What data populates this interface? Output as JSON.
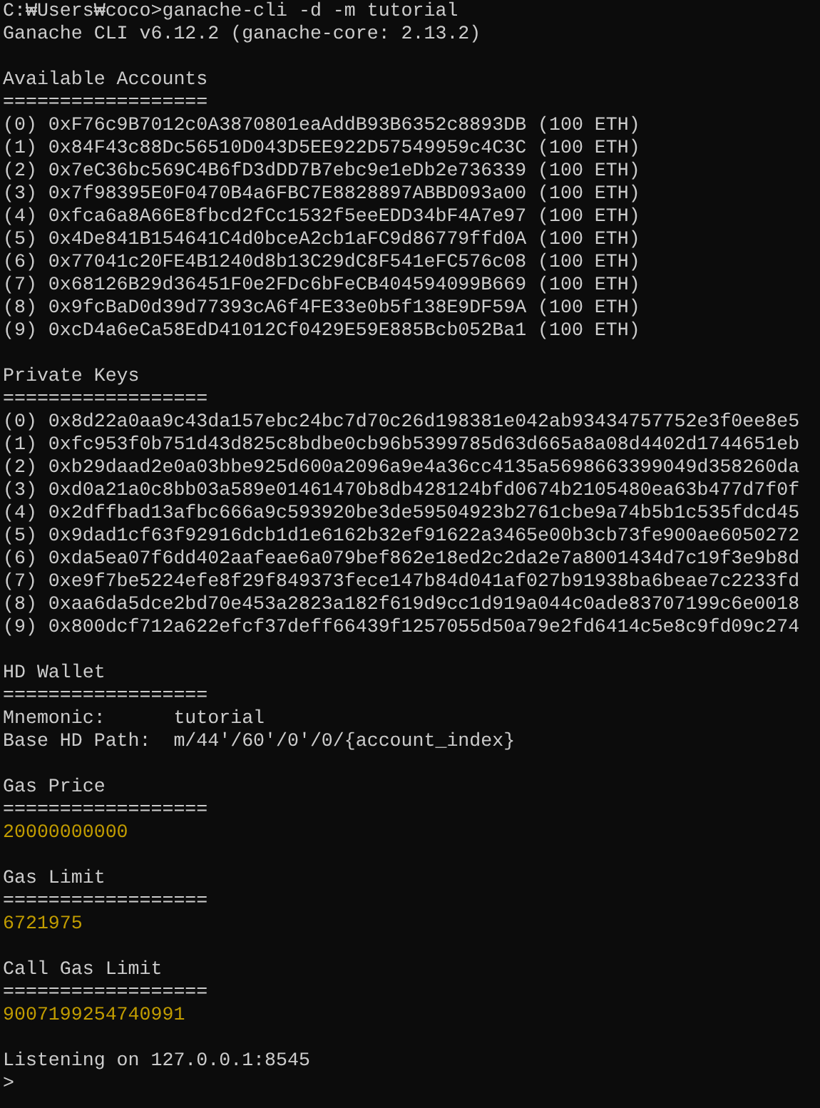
{
  "terminal": {
    "lines": [
      {
        "kind": "command",
        "text": "C:₩Users₩coco>ganache-cli -d -m tutorial"
      },
      {
        "kind": "output",
        "text": "Ganache CLI v6.12.2 (ganache-core: 2.13.2)"
      },
      {
        "kind": "blank"
      },
      {
        "kind": "output",
        "text": "Available Accounts"
      },
      {
        "kind": "output",
        "text": "=================="
      },
      {
        "kind": "output",
        "text": "(0) 0xF76c9B7012c0A3870801eaAddB93B6352c8893DB (100 ETH)"
      },
      {
        "kind": "output",
        "text": "(1) 0x84F43c88Dc56510D043D5EE922D57549959c4C3C (100 ETH)"
      },
      {
        "kind": "output",
        "text": "(2) 0x7eC36bc569C4B6fD3dDD7B7ebc9e1eDb2e736339 (100 ETH)"
      },
      {
        "kind": "output",
        "text": "(3) 0x7f98395E0F0470B4a6FBC7E8828897ABBD093a00 (100 ETH)"
      },
      {
        "kind": "output",
        "text": "(4) 0xfca6a8A66E8fbcd2fCc1532f5eeEDD34bF4A7e97 (100 ETH)"
      },
      {
        "kind": "output",
        "text": "(5) 0x4De841B154641C4d0bceA2cb1aFC9d86779ffd0A (100 ETH)"
      },
      {
        "kind": "output",
        "text": "(6) 0x77041c20FE4B1240d8b13C29dC8F541eFC576c08 (100 ETH)"
      },
      {
        "kind": "output",
        "text": "(7) 0x68126B29d36451F0e2FDc6bFeCB404594099B669 (100 ETH)"
      },
      {
        "kind": "output",
        "text": "(8) 0x9fcBaD0d39d77393cA6f4FE33e0b5f138E9DF59A (100 ETH)"
      },
      {
        "kind": "output",
        "text": "(9) 0xcD4a6eCa58EdD41012Cf0429E59E885Bcb052Ba1 (100 ETH)"
      },
      {
        "kind": "blank"
      },
      {
        "kind": "output",
        "text": "Private Keys"
      },
      {
        "kind": "output",
        "text": "=================="
      },
      {
        "kind": "output",
        "text": "(0) 0x8d22a0aa9c43da157ebc24bc7d70c26d198381e042ab93434757752e3f0ee8e5"
      },
      {
        "kind": "output",
        "text": "(1) 0xfc953f0b751d43d825c8bdbe0cb96b5399785d63d665a8a08d4402d1744651eb"
      },
      {
        "kind": "output",
        "text": "(2) 0xb29daad2e0a03bbe925d600a2096a9e4a36cc4135a5698663399049d358260da"
      },
      {
        "kind": "output",
        "text": "(3) 0xd0a21a0c8bb03a589e01461470b8db428124bfd0674b2105480ea63b477d7f0f"
      },
      {
        "kind": "output",
        "text": "(4) 0x2dffbad13afbc666a9c593920be3de59504923b2761cbe9a74b5b1c535fdcd45"
      },
      {
        "kind": "output",
        "text": "(5) 0x9dad1cf63f92916dcb1d1e6162b32ef91622a3465e00b3cb73fe900ae6050272"
      },
      {
        "kind": "output",
        "text": "(6) 0xda5ea07f6dd402aafeae6a079bef862e18ed2c2da2e7a8001434d7c19f3e9b8d"
      },
      {
        "kind": "output",
        "text": "(7) 0xe9f7be5224efe8f29f849373fece147b84d041af027b91938ba6beae7c2233fd"
      },
      {
        "kind": "output",
        "text": "(8) 0xaa6da5dce2bd70e453a2823a182f619d9cc1d919a044c0ade83707199c6e0018"
      },
      {
        "kind": "output",
        "text": "(9) 0x800dcf712a622efcf37deff66439f1257055d50a79e2fd6414c5e8c9fd09c274"
      },
      {
        "kind": "blank"
      },
      {
        "kind": "output",
        "text": "HD Wallet"
      },
      {
        "kind": "output",
        "text": "=================="
      },
      {
        "kind": "output",
        "text": "Mnemonic:      tutorial"
      },
      {
        "kind": "output",
        "text": "Base HD Path:  m/44'/60'/0'/0/{account_index}"
      },
      {
        "kind": "blank"
      },
      {
        "kind": "output",
        "text": "Gas Price"
      },
      {
        "kind": "output",
        "text": "=================="
      },
      {
        "kind": "number",
        "text": "20000000000"
      },
      {
        "kind": "blank"
      },
      {
        "kind": "output",
        "text": "Gas Limit"
      },
      {
        "kind": "output",
        "text": "=================="
      },
      {
        "kind": "number",
        "text": "6721975"
      },
      {
        "kind": "blank"
      },
      {
        "kind": "output",
        "text": "Call Gas Limit"
      },
      {
        "kind": "output",
        "text": "=================="
      },
      {
        "kind": "number",
        "text": "9007199254740991"
      },
      {
        "kind": "blank"
      },
      {
        "kind": "output",
        "text": "Listening on 127.0.0.1:8545"
      },
      {
        "kind": "prompt",
        "text": ">"
      }
    ]
  }
}
